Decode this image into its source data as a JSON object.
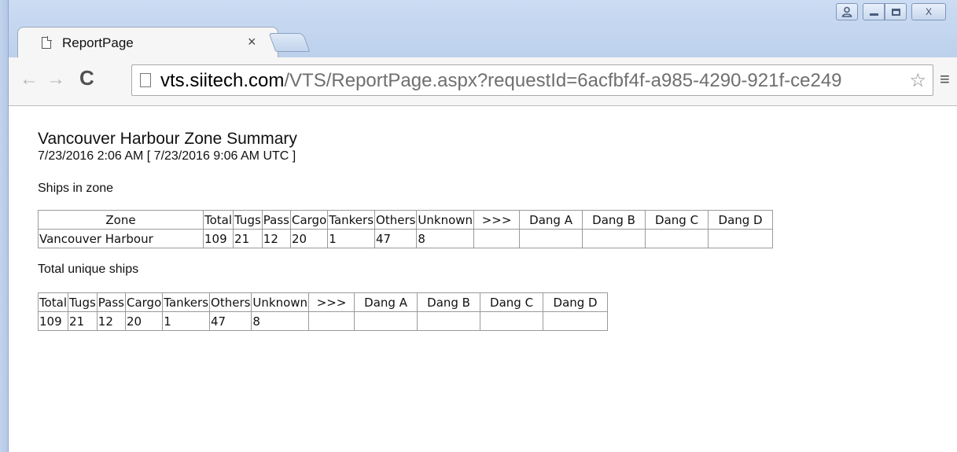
{
  "window": {
    "controls": {
      "user_icon": "user-icon",
      "minimize_icon": "minimize-icon",
      "maximize_icon": "maximize-icon",
      "close_label": "X"
    }
  },
  "tab": {
    "title": "ReportPage",
    "close": "×",
    "icon": "page-icon"
  },
  "toolbar": {
    "back": "←",
    "forward": "→",
    "reload": "C",
    "url_host": "vts.siitech.com",
    "url_path": "/VTS/ReportPage.aspx?requestId=6acfbf4f-a985-4290-921f-ce249",
    "star": "☆",
    "menu": "≡"
  },
  "report": {
    "title": "Vancouver Harbour Zone Summary",
    "date": "7/23/2016 2:06 AM [ 7/23/2016 9:06 AM UTC ]",
    "ships_in_zone": {
      "label": "Ships in zone",
      "headers": [
        "Zone",
        "Total",
        "Tugs",
        "Pass",
        "Cargo",
        "Tankers",
        "Others",
        "Unknown",
        ">>>",
        "Dang A",
        "Dang B",
        "Dang C",
        "Dang D"
      ],
      "row": [
        "Vancouver Harbour",
        "109",
        "21",
        "12",
        "20",
        "1",
        "47",
        "8",
        "",
        "",
        "",
        "",
        ""
      ]
    },
    "total_unique": {
      "label": "Total unique ships",
      "headers": [
        "Total",
        "Tugs",
        "Pass",
        "Cargo",
        "Tankers",
        "Others",
        "Unknown",
        ">>>",
        "Dang A",
        "Dang B",
        "Dang C",
        "Dang D"
      ],
      "row": [
        "109",
        "21",
        "12",
        "20",
        "1",
        "47",
        "8",
        "",
        "",
        "",
        "",
        ""
      ]
    }
  }
}
